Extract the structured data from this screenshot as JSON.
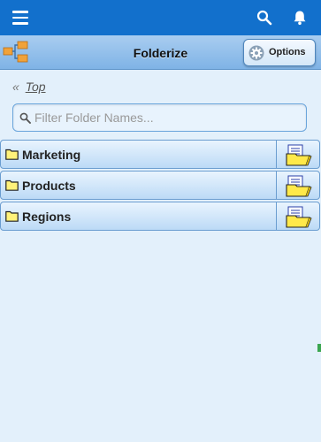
{
  "topbar": {
    "menu_icon": "hamburger-menu-icon",
    "search_icon": "search-icon",
    "bell_icon": "bell-icon",
    "color": "#1270cc"
  },
  "header": {
    "logo_icon": "folderize-logo-icon",
    "title": "Folderize",
    "options_label": "Options",
    "options_icon": "gear-icon"
  },
  "breadcrumb": {
    "separator": "«",
    "link": "Top"
  },
  "filter": {
    "placeholder": "Filter Folder Names...",
    "value": "",
    "icon": "search-icon"
  },
  "folders": [
    {
      "name": "Marketing",
      "icon": "folder-icon",
      "action_icon": "open-folder-documents-icon"
    },
    {
      "name": "Products",
      "icon": "folder-icon",
      "action_icon": "open-folder-documents-icon"
    },
    {
      "name": "Regions",
      "icon": "folder-icon",
      "action_icon": "open-folder-documents-icon"
    }
  ]
}
